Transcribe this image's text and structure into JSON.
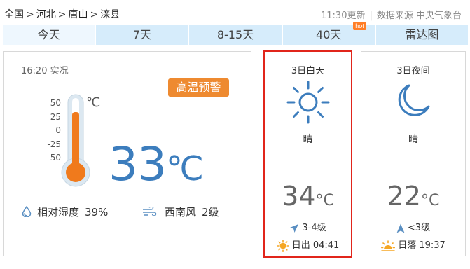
{
  "breadcrumb": {
    "items": [
      "全国",
      "河北",
      "唐山",
      "滦县"
    ],
    "separator": ">"
  },
  "header": {
    "update_time": "11:30更新",
    "source": "数据来源 中央气象台"
  },
  "tabs": [
    {
      "label": "今天",
      "active": true
    },
    {
      "label": "7天"
    },
    {
      "label": "8-15天"
    },
    {
      "label": "40天",
      "badge": "hot"
    },
    {
      "label": "雷达图"
    }
  ],
  "now": {
    "obs_time": "16:20 实况",
    "alert": "高温预警",
    "scale": [
      "50",
      "25",
      "0",
      "-25",
      "-50"
    ],
    "unit": "℃",
    "temperature": "33",
    "humidity_label": "相对湿度",
    "humidity_value": "39%",
    "wind_label": "西南风",
    "wind_value": "2级"
  },
  "day": {
    "title": "3日白天",
    "icon": "sun-icon",
    "desc": "晴",
    "temp": "34",
    "unit": "°C",
    "wind": "3-4级",
    "sun_label": "日出",
    "sun_time": "04:41"
  },
  "night": {
    "title": "3日夜间",
    "icon": "moon-icon",
    "desc": "晴",
    "temp": "22",
    "unit": "°C",
    "wind": "<3级",
    "sun_label": "日落",
    "sun_time": "19:37"
  },
  "colors": {
    "tab_bg": "#d6ecfb",
    "temp_blue": "#3c7dbd",
    "alert_orange": "#ee8a30",
    "highlight_red": "#e1251b",
    "thermo_fill": "#f07a1c"
  }
}
